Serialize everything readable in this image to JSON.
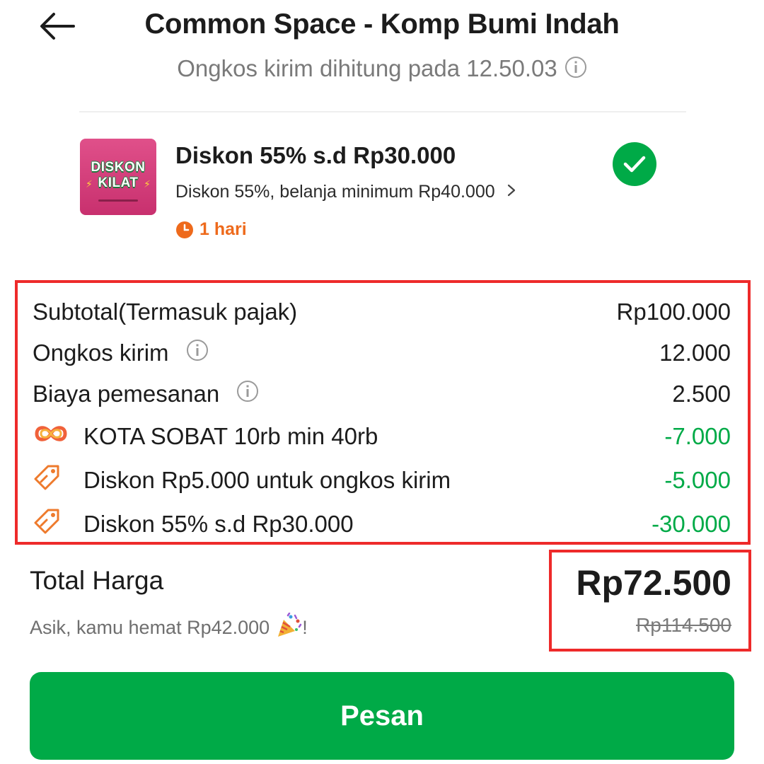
{
  "header": {
    "title": "Common Space - Komp Bumi Indah",
    "subtitle": "Ongkos kirim dihitung pada 12.50.03",
    "back_icon": "arrow-left-icon",
    "info_icon": "info-icon"
  },
  "voucher": {
    "thumb_line1": "DISKON",
    "thumb_line2": "KILAT",
    "title": "Diskon 55% s.d Rp30.000",
    "description": "Diskon 55%, belanja minimum Rp40.000",
    "expiry": "1 hari",
    "selected": true
  },
  "breakdown": [
    {
      "label": "Subtotal(Termasuk pajak)",
      "value": "Rp100.000",
      "icon": "",
      "info": false,
      "discount": false
    },
    {
      "label": "Ongkos kirim",
      "value": "12.000",
      "icon": "",
      "info": true,
      "discount": false
    },
    {
      "label": "Biaya pemesanan",
      "value": "2.500",
      "icon": "",
      "info": true,
      "discount": false
    },
    {
      "label": "KOTA SOBAT 10rb min 40rb",
      "value": "-7.000",
      "icon": "subscription-loop-icon",
      "info": false,
      "discount": true
    },
    {
      "label": "Diskon Rp5.000 untuk ongkos kirim",
      "value": "-5.000",
      "icon": "tag-icon",
      "info": false,
      "discount": true
    },
    {
      "label": "Diskon 55% s.d Rp30.000",
      "value": "-30.000",
      "icon": "tag-icon",
      "info": false,
      "discount": true
    }
  ],
  "total": {
    "label": "Total Harga",
    "price": "Rp72.500",
    "original_price": "Rp114.500",
    "saving_text": "Asik, kamu hemat Rp42.000",
    "saving_suffix": "!",
    "saving_icon": "party-popper-icon"
  },
  "order_button": {
    "label": "Pesan"
  },
  "colors": {
    "brand_green": "#00aa47",
    "discount_green": "#00aa47",
    "highlight_red": "#ee2a2a",
    "expiry_orange": "#ee6a1c"
  }
}
